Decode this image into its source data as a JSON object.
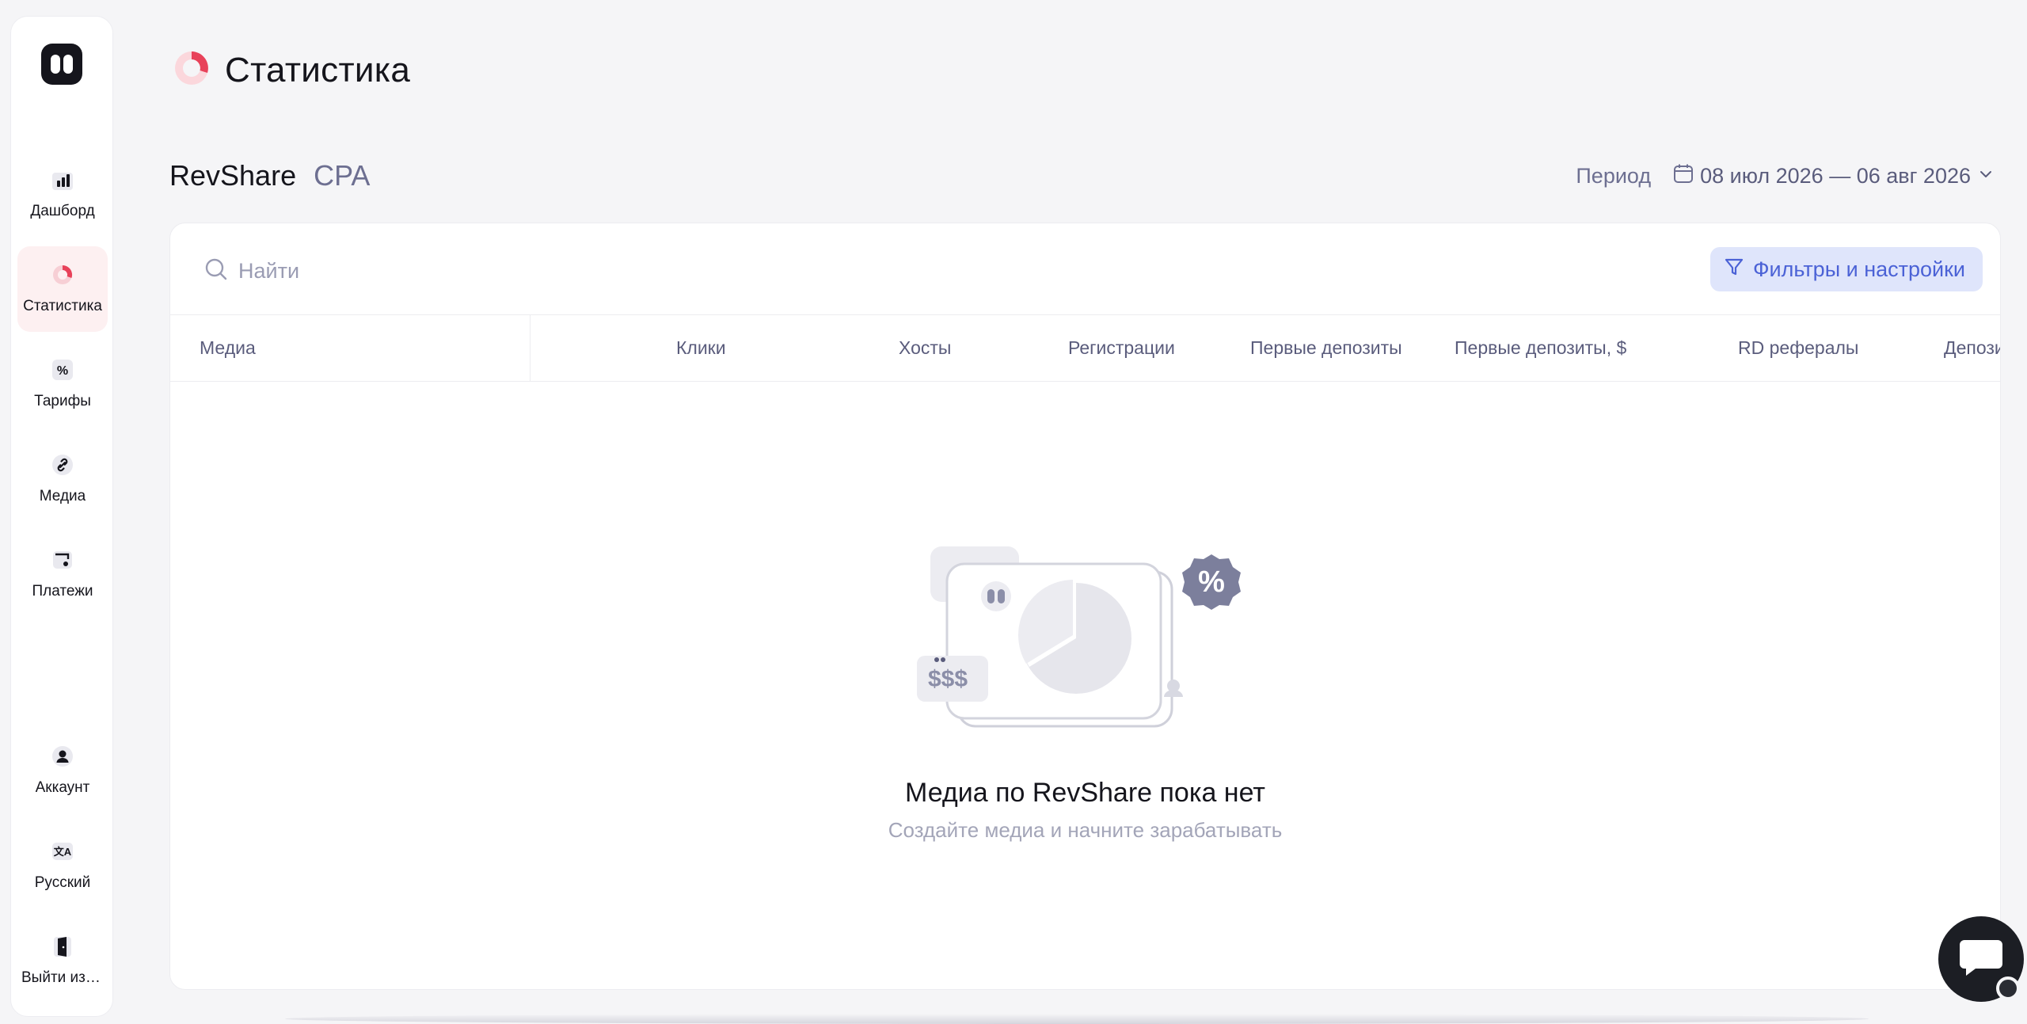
{
  "sidebar": {
    "items": [
      {
        "label": "Дашборд",
        "icon": "bar-chart-icon"
      },
      {
        "label": "Статистика",
        "icon": "pie-chart-icon"
      },
      {
        "label": "Тарифы",
        "icon": "percent-icon"
      },
      {
        "label": "Медиа",
        "icon": "link-icon"
      },
      {
        "label": "Платежи",
        "icon": "wallet-icon"
      }
    ],
    "bottom": [
      {
        "label": "Аккаунт",
        "icon": "user-icon"
      },
      {
        "label": "Русский",
        "icon": "translate-icon"
      },
      {
        "label": "Выйти из аккаунта",
        "icon": "logout-door-icon"
      }
    ]
  },
  "page": {
    "title": "Статистика"
  },
  "tabs": [
    {
      "label": "RevShare",
      "active": true
    },
    {
      "label": "CPA",
      "active": false
    }
  ],
  "period": {
    "label": "Период",
    "value": "08 июл 2026 — 06 авг 2026"
  },
  "search": {
    "placeholder": "Найти"
  },
  "filters_button": {
    "label": "Фильтры и настройки"
  },
  "table": {
    "columns": [
      "Медиа",
      "Клики",
      "Хосты",
      "Регистрации",
      "Первые депозиты",
      "Первые депозиты, $",
      "RD рефералы",
      "Депозиты"
    ]
  },
  "empty_state": {
    "illustration_label": "$$$",
    "title": "Медиа по RevShare пока нет",
    "subtitle": "Создайте медиа и начните зарабатывать"
  },
  "colors": {
    "accent": "#4b62d6",
    "accent_bg": "#dfe5fb",
    "brand_red": "#e8425a",
    "muted": "#6d6f91"
  }
}
